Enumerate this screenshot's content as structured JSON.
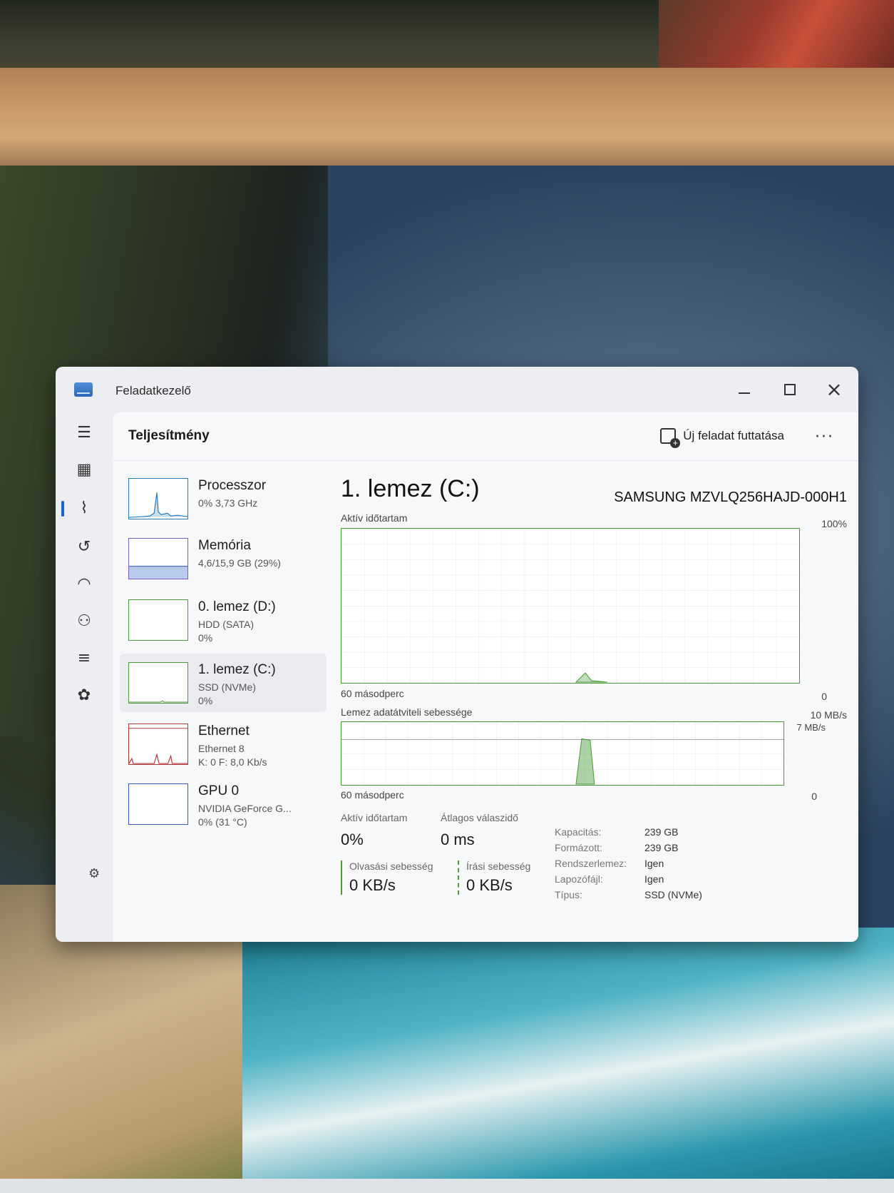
{
  "window": {
    "title": "Feladatkezelő"
  },
  "header": {
    "page_title": "Teljesítmény",
    "run_task_label": "Új feladat futtatása",
    "more_label": "···"
  },
  "nav": {
    "items": [
      "menu-icon",
      "processes-icon",
      "performance-icon",
      "app-history-icon",
      "startup-icon",
      "users-icon",
      "details-icon",
      "services-icon"
    ],
    "active": "performance-icon",
    "settings": "settings-icon"
  },
  "resources": [
    {
      "name": "Processzor",
      "sub1": "0% 3,73 GHz",
      "sub2": "",
      "sub3": ""
    },
    {
      "name": "Memória",
      "sub1": "4,6/15,9 GB (29%)",
      "sub2": "",
      "sub3": ""
    },
    {
      "name": "0. lemez (D:)",
      "sub1": "HDD (SATA)",
      "sub2": "0%",
      "sub3": ""
    },
    {
      "name": "1. lemez (C:)",
      "sub1": "SSD (NVMe)",
      "sub2": "0%",
      "sub3": ""
    },
    {
      "name": "Ethernet",
      "sub1": "Ethernet 8",
      "sub2": "K: 0 F: 8,0 Kb/s",
      "sub3": ""
    },
    {
      "name": "GPU 0",
      "sub1": "NVIDIA GeForce G...",
      "sub2": "0% (31 °C)",
      "sub3": ""
    }
  ],
  "selected_resource": 3,
  "detail": {
    "title": "1. lemez (C:)",
    "model": "SAMSUNG MZVLQ256HAJD-000H1",
    "graph1": {
      "label": "Aktív időtartam",
      "max": "100%",
      "xlabel": "60 másodperc",
      "min": "0"
    },
    "graph2": {
      "label": "Lemez adatátviteli sebessége",
      "max": "10 MB/s",
      "line_label": "7 MB/s",
      "xlabel": "60 másodperc",
      "min": "0"
    },
    "stats": {
      "active_label": "Aktív időtartam",
      "active_value": "0%",
      "response_label": "Átlagos válaszidő",
      "response_value": "0 ms",
      "read_label": "Olvasási sebesség",
      "read_value": "0 KB/s",
      "write_label": "Írási sebesség",
      "write_value": "0 KB/s"
    },
    "properties": [
      {
        "key": "Kapacitás:",
        "value": "239 GB"
      },
      {
        "key": "Formázott:",
        "value": "239 GB"
      },
      {
        "key": "Rendszerlemez:",
        "value": "Igen"
      },
      {
        "key": "Lapozófájl:",
        "value": "Igen"
      },
      {
        "key": "Típus:",
        "value": "SSD (NVMe)"
      }
    ]
  },
  "colors": {
    "disk_accent": "#4a9a3a",
    "cpu_accent": "#2a7ab5",
    "net_accent": "#b03a3a",
    "mem_accent": "#7c5dbf"
  }
}
